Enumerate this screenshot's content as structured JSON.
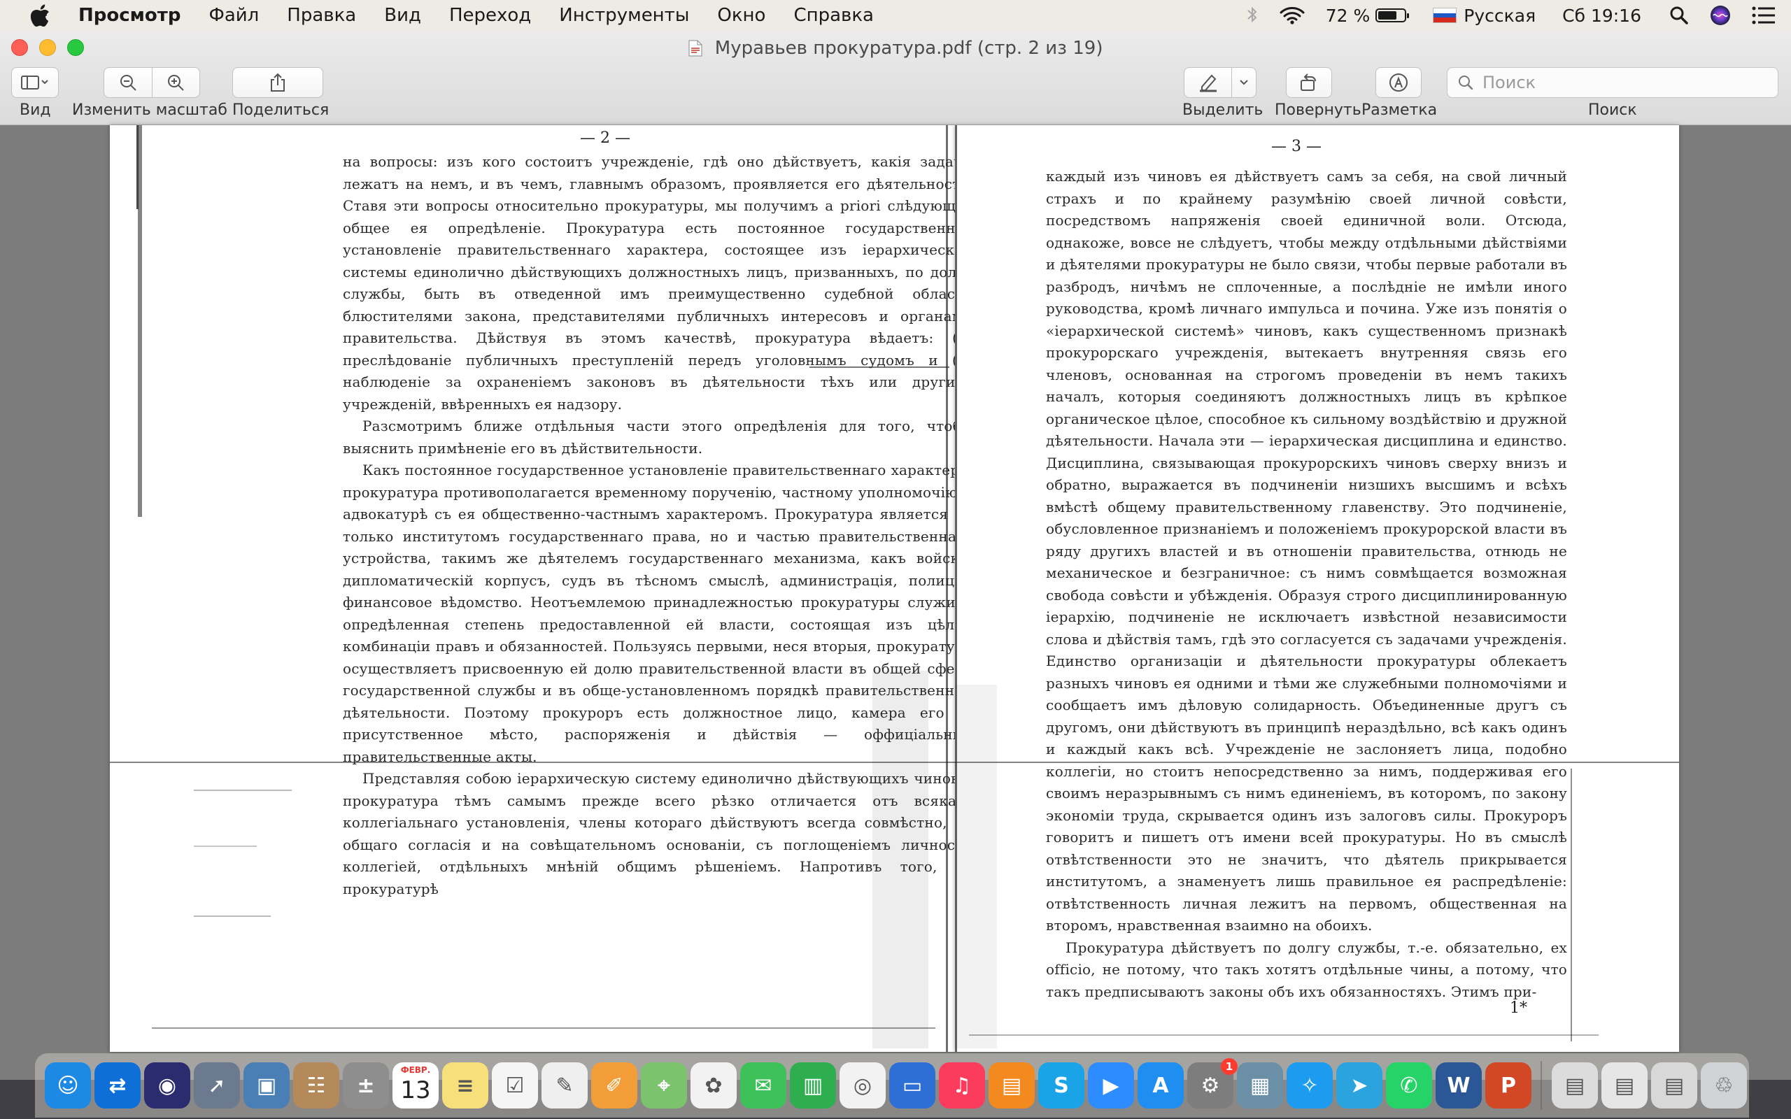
{
  "menubar": {
    "app_name": "Просмотр",
    "items": [
      "Файл",
      "Правка",
      "Вид",
      "Переход",
      "Инструменты",
      "Окно",
      "Справка"
    ],
    "battery_percent": "72 %",
    "battery_level": 0.72,
    "input_language": "Русская",
    "clock": "Сб 19:16",
    "icons": [
      "apple-icon",
      "bluetooth-icon",
      "wifi-icon",
      "battery-icon",
      "flag-ru-icon",
      "spotlight-icon",
      "siri-icon",
      "notification-center-icon"
    ]
  },
  "window": {
    "title": "Муравьев прокуратура.pdf (стр. 2 из 19)",
    "toolbar": {
      "view_label": "Вид",
      "zoom_label": "Изменить масштаб",
      "share_label": "Поделиться",
      "highlight_label": "Выделить",
      "rotate_label": "Повернуть",
      "markup_label": "Разметка",
      "search_label": "Поиск",
      "search_placeholder": "Поиск"
    }
  },
  "pages": {
    "left": {
      "number": "— 2 —",
      "paragraphs": [
        "на вопросы: изъ кого состоитъ учрежденіе, гдѣ оно дѣйствуетъ, какія задачи лежатъ на немъ, и въ чемъ, главнымъ образомъ, проявляется его дѣятельность. Ставя эти вопросы относительно прокуратуры, мы получимъ a priori слѣдующее общее ея опредѣленіе. Прокуратура есть постоянное государственное установленіе правительственнаго характера, состоящее изъ іерархической системы единолично дѣйствующихъ должностныхъ лицъ, призванныхъ, по долгу службы, быть въ отведенной имъ преимущественно судебной области блюстителями закона, представителями публичныхъ интересовъ и органами правительства. Дѣйствуя въ этомъ качествѣ, прокуратура вѣдаетъ: (1) преслѣдованіе публичныхъ преступленій передъ уголовнымъ судомъ и (2) наблюденіе за охраненіемъ законовъ въ дѣятельности тѣхъ или другихъ учрежденій, ввѣренныхъ ея надзору.",
        "Разсмотримъ ближе отдѣльныя части этого опредѣленія для того, чтобы выяснить примѣненіе его въ дѣйствительности.",
        "Какъ постоянное государственное установленіе правительственнаго характера, прокуратура противополагается временному порученію, частному уполномочію и адвокатурѣ съ ея общественно-частнымъ характеромъ. Прокуратура является не только институтомъ государственнаго права, но и частью правительственнаго устройства, такимъ же дѣятелемъ государственнаго механизма, какъ войско, дипломатическій корпусъ, судъ въ тѣсномъ смыслѣ, администрація, полиція, финансовое вѣдомство. Неотъемлемою принадлежностью прокуратуры служитъ опредѣленная степень предоставленной ей власти, состоящая изъ цѣлой комбинаціи правъ и обязанностей. Пользуясь первыми, неся вторыя, прокуратура осуществляетъ присвоенную ей долю правительственной власти въ общей сферѣ государственной службы и въ обще-установленномъ порядкѣ правительственной дѣятельности. Поэтому прокуроръ есть должностное лицо, камера его — присутственное мѣсто, распоряженія и дѣйствія — оффиціальные правительственные акты.",
        "Представляя собою іерархическую систему единолично дѣйствующихъ чиновъ, прокуратура тѣмъ самымъ прежде всего рѣзко отличается отъ всякаго коллегіальнаго установленія, члены котораго дѣйствуютъ всегда совмѣстно, съ общаго согласія и на совѣщательномъ основаніи, съ поглощеніемъ личности коллегіей, отдѣльныхъ мнѣній общимъ рѣшеніемъ. Напротивъ того, въ прокуратурѣ"
      ]
    },
    "right": {
      "number": "— 3 —",
      "paragraphs": [
        "каждый изъ чиновъ ея дѣйствуетъ самъ за себя, на свой личный страхъ и по крайнему разумѣнію своей личной совѣсти, посредствомъ напряженія своей единичной воли. Отсюда, однакоже, вовсе не слѣдуетъ, чтобы между отдѣльными дѣйствіями и дѣятелями прокуратуры не было связи, чтобы первые работали въ разбродъ, ничѣмъ не сплоченные, а послѣдніе не имѣли иного руководства, кромѣ личнаго импульса и почина. Уже изъ понятія о «іерархической системѣ» чиновъ, какъ существенномъ признакѣ прокурорскаго учрежденія, вытекаетъ внутренняя связь его членовъ, основанная на строгомъ проведеніи въ немъ такихъ началъ, которыя соединяютъ должностныхъ лицъ въ крѣпкое органическое цѣлое, способное къ сильному воздѣйствію и дружной дѣятельности. Начала эти — іерархическая дисциплина и единство. Дисциплина, связывающая прокурорскихъ чиновъ сверху внизъ и обратно, выражается въ подчиненіи низшихъ высшимъ и всѣхъ вмѣстѣ общему правительственному главенству. Это подчиненіе, обусловленное признаніемъ и положеніемъ прокурорской власти въ ряду другихъ властей и въ отношеніи правительства, отнюдь не механическое и безграничное: съ нимъ совмѣщается возможная свобода совѣсти и убѣжденія. Образуя строго дисциплинированную іерархію, подчиненіе не исключаетъ извѣстной независимости слова и дѣйствія тамъ, гдѣ это согласуется съ задачами учрежденія. Единство организаціи и дѣятельности прокуратуры облекаетъ разныхъ чиновъ ея одними и тѣми же служебными полномочіями и сообщаетъ имъ дѣловую солидарность. Объединенные другъ съ другомъ, они дѣйствуютъ въ принципѣ нераздѣльно, всѣ какъ одинъ и каждый какъ всѣ. Учрежденіе не заслоняетъ лица, подобно коллегіи, но стоитъ непосредственно за нимъ, поддерживая его своимъ неразрывнымъ съ нимъ единеніемъ, въ которомъ, по закону экономіи труда, скрывается одинъ изъ залоговъ силы. Прокуроръ говоритъ и пишетъ отъ имени всей прокуратуры. Но въ смыслѣ отвѣтственности это не значитъ, что дѣятель прикрывается институтомъ, а знаменуетъ лишь правильное ея распредѣленіе: отвѣтственность личная лежитъ на первомъ, общественная на второмъ, нравственная взаимно на обоихъ.",
        "Прокуратура дѣйствуетъ по долгу службы, т.-е. обязательно, ex officio, не потому, что такъ хотятъ отдѣльные чины, а потому, что такъ предписываютъ законы объ ихъ обязанностяхъ. Этимъ при-"
      ],
      "footnote": "1*"
    }
  },
  "dock": {
    "calendar_month": "ФЕВР.",
    "calendar_day": "13",
    "system_prefs_badge": "1",
    "apps": [
      {
        "name": "finder-icon",
        "color": "#1e88e5"
      },
      {
        "name": "teamviewer-icon",
        "color": "#0e6fd8"
      },
      {
        "name": "siri-dock-icon",
        "color": "#2b2b6f"
      },
      {
        "name": "launchpad-icon",
        "color": "#6b7a8f"
      },
      {
        "name": "preview-icon",
        "color": "#4a7fb5"
      },
      {
        "name": "contacts-icon",
        "color": "#b48a5a"
      },
      {
        "name": "calculator-icon",
        "color": "#8e8e8e"
      },
      {
        "name": "calendar-icon",
        "color": "#ffffff"
      },
      {
        "name": "notes-icon",
        "color": "#f7e07b"
      },
      {
        "name": "reminders-icon",
        "color": "#f5f5f5"
      },
      {
        "name": "textedit-icon",
        "color": "#efefef"
      },
      {
        "name": "pages-icon",
        "color": "#f29d38"
      },
      {
        "name": "maps-icon",
        "color": "#7cc36e"
      },
      {
        "name": "photos-icon",
        "color": "#f2f2f2"
      },
      {
        "name": "messages-icon",
        "color": "#3ec158"
      },
      {
        "name": "numbers-icon",
        "color": "#2fae50"
      },
      {
        "name": "chrome-icon",
        "color": "#f2f2f2"
      },
      {
        "name": "keynote-icon",
        "color": "#2e6fd6"
      },
      {
        "name": "music-icon",
        "color": "#fb3c5c"
      },
      {
        "name": "books-icon",
        "color": "#f28a1f"
      },
      {
        "name": "skype-icon",
        "color": "#1aa3e6"
      },
      {
        "name": "zoom-icon",
        "color": "#2d8cff"
      },
      {
        "name": "app-store-icon",
        "color": "#1f8ef1"
      },
      {
        "name": "system-preferences-icon",
        "color": "#7d7d7d"
      },
      {
        "name": "image-capture-icon",
        "color": "#6c8fa8"
      },
      {
        "name": "safari-icon",
        "color": "#1d9bf0"
      },
      {
        "name": "telegram-icon",
        "color": "#2aa3de"
      },
      {
        "name": "whatsapp-icon",
        "color": "#25d366"
      },
      {
        "name": "word-icon",
        "color": "#2b5797"
      },
      {
        "name": "powerpoint-icon",
        "color": "#d24726"
      },
      {
        "name": "downloads-stack-icon",
        "color": "#dcdcdc"
      },
      {
        "name": "documents-stack-icon",
        "color": "#e6e6e6"
      },
      {
        "name": "desktop-stack-icon",
        "color": "#d8d8d8"
      },
      {
        "name": "trash-icon",
        "color": "#cfd3d6"
      }
    ]
  }
}
